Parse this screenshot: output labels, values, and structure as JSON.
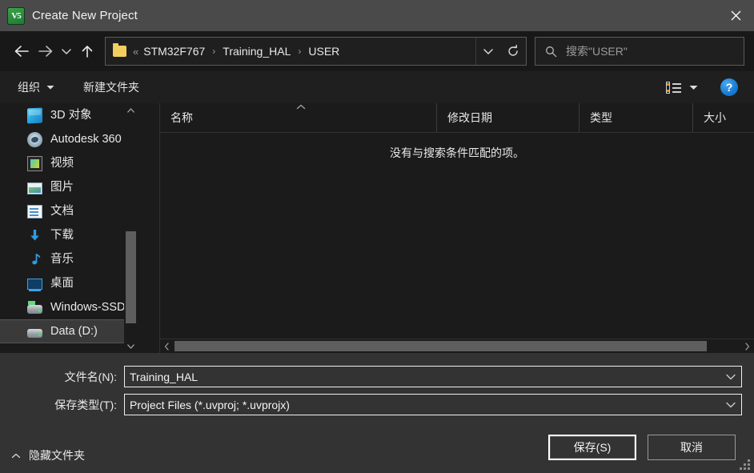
{
  "window": {
    "title": "Create New Project",
    "app_icon": "keil-uvision-icon",
    "icon_glyph": "V5",
    "close_label": "✕"
  },
  "nav": {
    "back_icon": "arrow-left-icon",
    "forward_icon": "arrow-right-icon",
    "recent_icon": "chevron-down-icon",
    "up_icon": "arrow-up-icon",
    "address": {
      "folder_icon": "folder-icon",
      "overflow": "«",
      "crumbs": [
        "STM32F767",
        "Training_HAL",
        "USER"
      ],
      "separator": "›",
      "dropdown_icon": "chevron-down-icon",
      "refresh_icon": "refresh-icon"
    },
    "search": {
      "icon": "search-icon",
      "value": "搜索\"USER\""
    }
  },
  "toolbar": {
    "organize_label": "组织",
    "organize_caret": "▾",
    "new_folder_label": "新建文件夹",
    "view_mode_icon": "list-view-icon",
    "view_mode_caret_icon": "chevron-down-icon",
    "help_label": "?",
    "help_icon": "help-icon"
  },
  "sidebar": {
    "items": [
      {
        "label": "3D 对象",
        "icon": "cube-3d-icon",
        "selected": false
      },
      {
        "label": "Autodesk 360",
        "icon": "autodesk-icon",
        "selected": false
      },
      {
        "label": "视频",
        "icon": "videos-icon",
        "selected": false
      },
      {
        "label": "图片",
        "icon": "pictures-icon",
        "selected": false
      },
      {
        "label": "文档",
        "icon": "documents-icon",
        "selected": false
      },
      {
        "label": "下载",
        "icon": "downloads-icon",
        "selected": false
      },
      {
        "label": "音乐",
        "icon": "music-icon",
        "selected": false
      },
      {
        "label": "桌面",
        "icon": "desktop-icon",
        "selected": false
      },
      {
        "label": "Windows-SSD",
        "icon": "ssd-drive-icon",
        "selected": false
      },
      {
        "label": "Data (D:)",
        "icon": "hard-drive-icon",
        "selected": true
      }
    ],
    "scroll_up_icon": "chevron-up-icon",
    "scroll_down_icon": "chevron-down-icon"
  },
  "filelist": {
    "columns": [
      {
        "label": "名称",
        "sorted": "asc"
      },
      {
        "label": "修改日期",
        "sorted": ""
      },
      {
        "label": "类型",
        "sorted": ""
      },
      {
        "label": "大小",
        "sorted": ""
      }
    ],
    "sort_caret": "˄",
    "rows": [],
    "empty_message": "没有与搜索条件匹配的项。",
    "hscroll_left_icon": "chevron-left-icon",
    "hscroll_right_icon": "chevron-right-icon"
  },
  "footer": {
    "filename_label": "文件名(N):",
    "filename_value": "Training_HAL",
    "filetype_label": "保存类型(T):",
    "filetype_value": "Project Files (*.uvproj; *.uvprojx)",
    "combo_caret_icon": "chevron-down-icon",
    "hide_folders_label": "隐藏文件夹",
    "hide_folders_caret": "˄",
    "save_label": "保存(S)",
    "cancel_label": "取消",
    "resize_grip_icon": "resize-grip-icon"
  },
  "colors": {
    "titlebar": "#4a4a4a",
    "dialog_bg": "#333333",
    "panel_bg": "#1b1b1b",
    "navbar_bg": "#181818",
    "accent_blue": "#1b7fd6",
    "folder_yellow": "#f3cf5f",
    "selection": "#3a3a3a"
  }
}
